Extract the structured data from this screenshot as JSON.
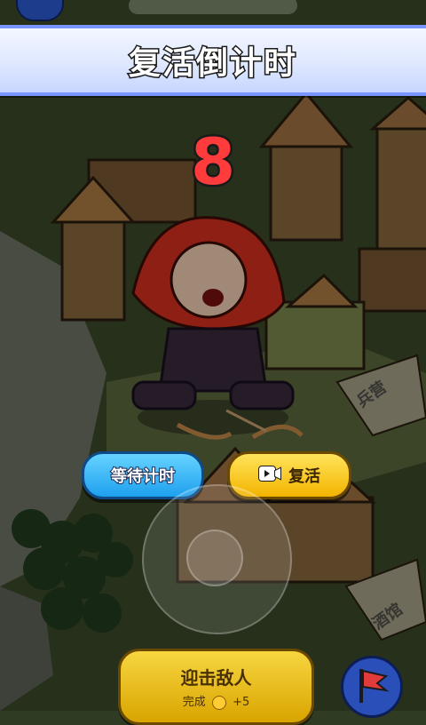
{
  "banner": {
    "title": "复活倒计时"
  },
  "countdown": {
    "value": "8"
  },
  "buttons": {
    "wait_label": "等待计时",
    "revive_label": "复活"
  },
  "task": {
    "title": "迎击敌人",
    "subtitle_prefix": "完成",
    "reward": "+5"
  },
  "map_labels": {
    "base": "兵营",
    "tavern": "酒馆"
  },
  "colors": {
    "banner_border": "#7b95ff",
    "countdown": "#ff3b3b",
    "wait_button": "#1ea0ee",
    "revive_button": "#f3b400"
  },
  "icons": [
    "video-icon",
    "coin-icon",
    "flag-icon"
  ]
}
